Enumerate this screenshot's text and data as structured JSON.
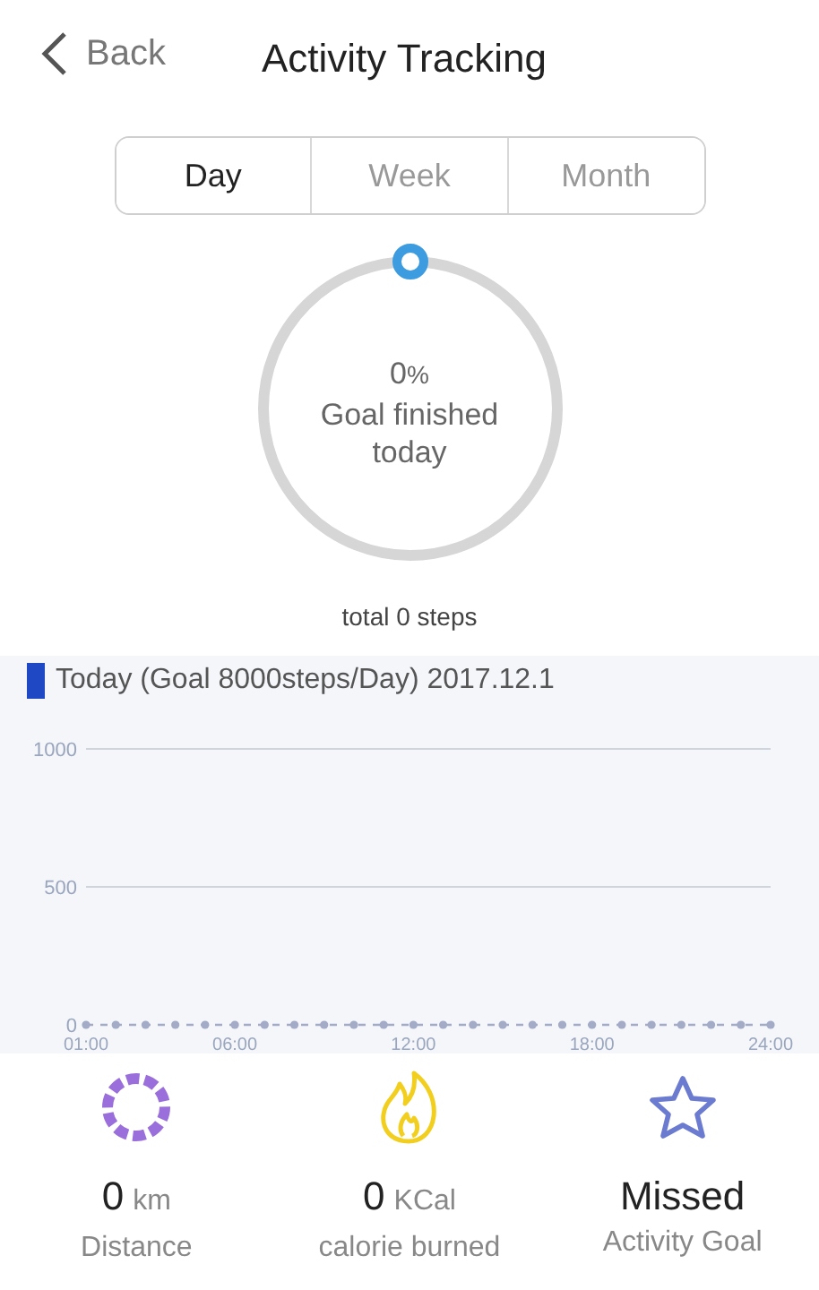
{
  "header": {
    "back": "Back",
    "title": "Activity Tracking"
  },
  "tabs": [
    {
      "label": "Day",
      "selected": true
    },
    {
      "label": "Week",
      "selected": false
    },
    {
      "label": "Month",
      "selected": false
    }
  ],
  "goal_ring": {
    "percent": "0",
    "percent_unit": "%",
    "caption": "Goal finished today"
  },
  "total": "total 0 steps",
  "chart": {
    "chart_data": {
      "type": "line",
      "title": "Today (Goal 8000steps/Day) 2017.12.1",
      "x": [
        1,
        2,
        3,
        4,
        5,
        6,
        7,
        8,
        9,
        10,
        11,
        12,
        13,
        14,
        15,
        16,
        17,
        18,
        19,
        20,
        21,
        22,
        23,
        24
      ],
      "xlim": [
        1,
        24
      ],
      "series": [
        {
          "color": "#a3abc6",
          "line_style": "dashed",
          "marker": "circle",
          "values": [
            0,
            0,
            0,
            0,
            0,
            0,
            0,
            0,
            0,
            0,
            0,
            0,
            0,
            0,
            0,
            0,
            0,
            0,
            0,
            0,
            0,
            0,
            0,
            0
          ]
        }
      ],
      "ylim": [
        0,
        1000
      ],
      "yticks": [
        {
          "value": 0,
          "label": "0"
        },
        {
          "value": 500,
          "label": "500"
        },
        {
          "value": 1000,
          "label": "1000"
        }
      ],
      "xticks": [
        {
          "value": 1,
          "label": "01:00"
        },
        {
          "value": 6,
          "label": "06:00"
        },
        {
          "value": 12,
          "label": "12:00"
        },
        {
          "value": 18,
          "label": "18:00"
        },
        {
          "value": 24,
          "label": "24:00"
        }
      ]
    }
  },
  "stats": [
    {
      "kind": "distance",
      "value": "0",
      "unit": "km",
      "label": "Distance"
    },
    {
      "kind": "calories",
      "value": "0",
      "unit": "KCal",
      "label": "calorie burned"
    },
    {
      "kind": "goal",
      "value": "Missed",
      "label": "Activity Goal"
    }
  ]
}
